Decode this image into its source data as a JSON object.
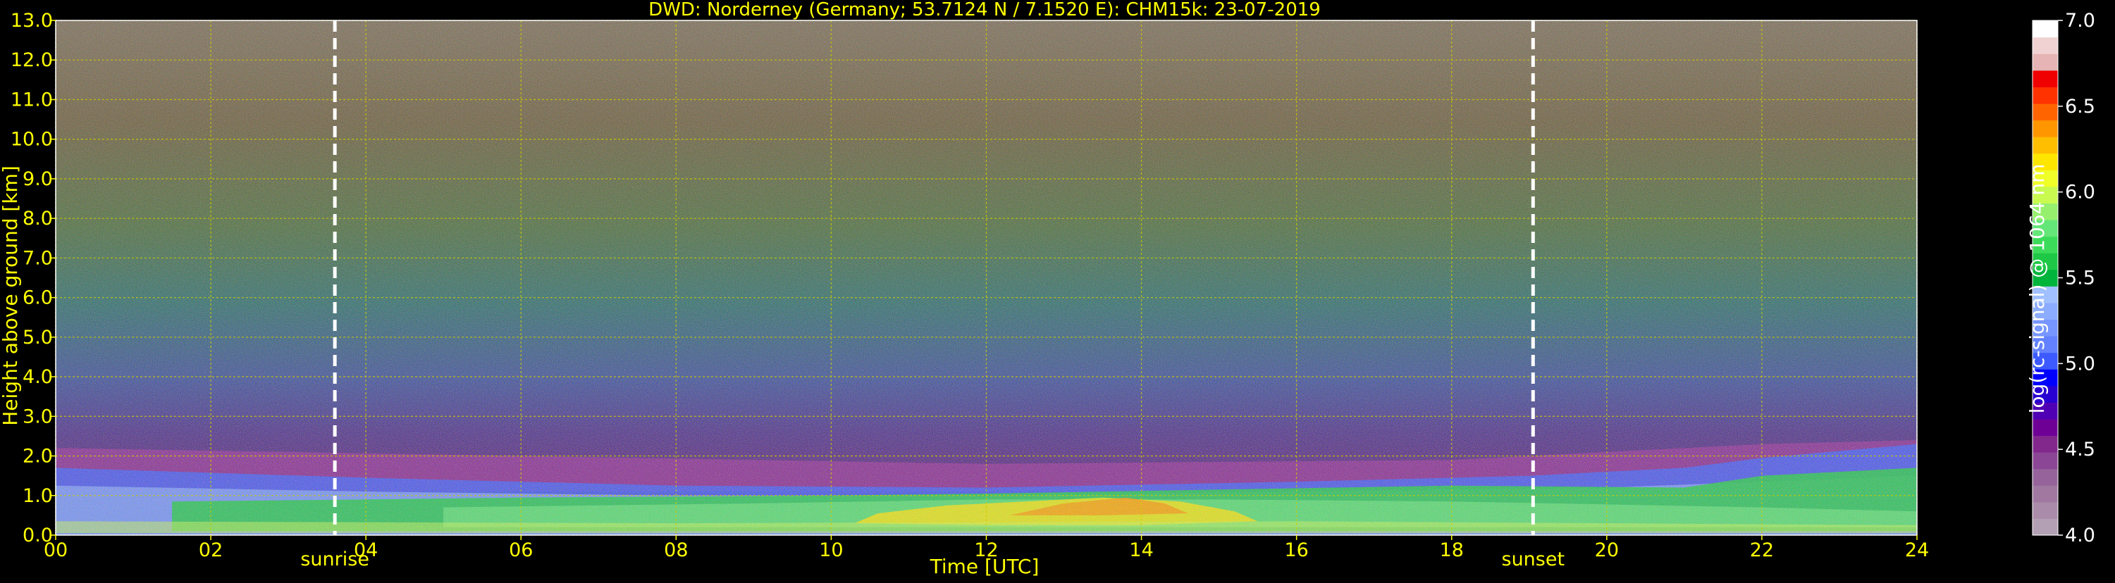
{
  "chart_data": {
    "type": "heatmap",
    "title": "DWD: Norderney (Germany; 53.7124 N / 7.1520 E):    CHM15k: 23-07-2019",
    "xlabel": "Time [UTC]",
    "ylabel": "Height above ground [km]",
    "xlim": [
      0,
      24
    ],
    "ylim": [
      0,
      13
    ],
    "x_ticks": [
      "00",
      "02",
      "04",
      "06",
      "08",
      "10",
      "12",
      "14",
      "16",
      "18",
      "20",
      "22",
      "24"
    ],
    "y_ticks": [
      "0.0",
      "1.0",
      "2.0",
      "3.0",
      "4.0",
      "5.0",
      "6.0",
      "7.0",
      "8.0",
      "9.0",
      "10.0",
      "11.0",
      "12.0",
      "13.0"
    ],
    "grid": true,
    "colorbar": {
      "label": "log(rc-signal) @ 1064 nm",
      "range": [
        4.0,
        7.0
      ],
      "ticks": [
        "4.0",
        "4.5",
        "5.0",
        "5.5",
        "6.0",
        "6.5",
        "7.0"
      ],
      "colors": [
        "#b4a0b4",
        "#aa8caa",
        "#a078a0",
        "#96649b",
        "#8c4696",
        "#82288c",
        "#6e0096",
        "#5000b4",
        "#2800d2",
        "#0000ff",
        "#3c5aff",
        "#6482ff",
        "#7896ff",
        "#8cacff",
        "#a0c0ff",
        "#00b43c",
        "#1ec846",
        "#3cdc5a",
        "#64e678",
        "#96f06e",
        "#c8fa50",
        "#f0ff28",
        "#ffe600",
        "#ffbe00",
        "#ff9600",
        "#ff6400",
        "#ff3200",
        "#f00000",
        "#e6b4b4",
        "#f0d2d2",
        "#ffffff"
      ]
    },
    "annotations": [
      {
        "label": "sunrise",
        "time": 3.6
      },
      {
        "label": "sunset",
        "time": 19.05
      }
    ],
    "layers": {
      "cloud_top_km": 1.7,
      "aerosol_core_top_km": 1.0,
      "note_colors": {
        "background_low": "#82288c",
        "aerosol": "#3c5aff",
        "dense": "#1ec846",
        "peak": "#ffe600"
      }
    }
  },
  "colors": {
    "background": "#000000",
    "text": "#ffff00",
    "grid": "#cccc00",
    "colorbar_text": "#ffffff",
    "marker": "#ffffff"
  }
}
